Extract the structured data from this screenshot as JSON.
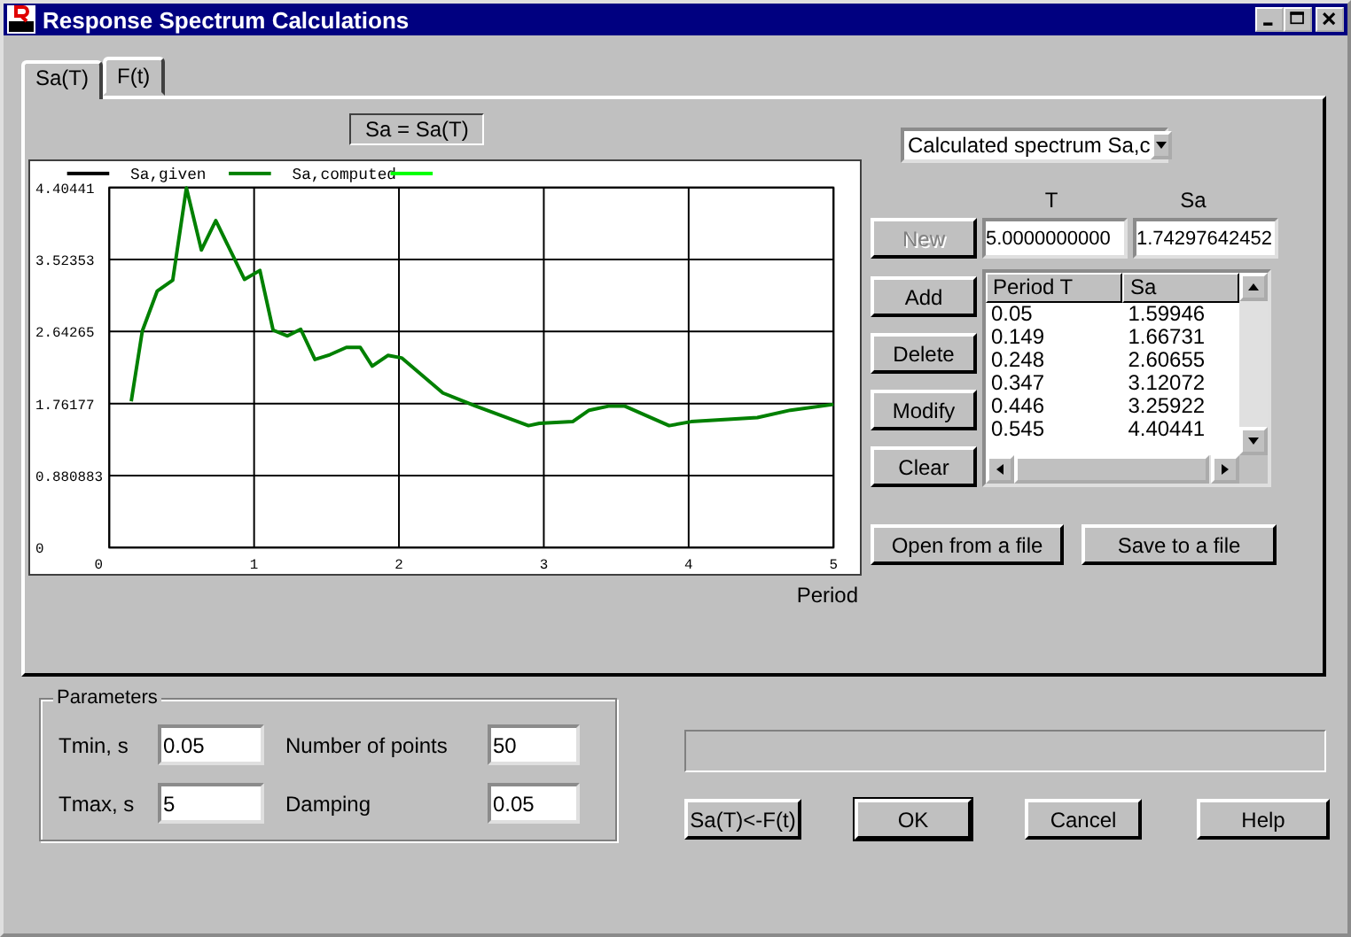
{
  "window": {
    "title": "Response Spectrum Calculations"
  },
  "tabs": [
    {
      "label": "Sa(T)",
      "selected": true
    },
    {
      "label": "F(t)",
      "selected": false
    }
  ],
  "chart": {
    "caption": "Sa = Sa(T)",
    "chart_data": {
      "type": "line",
      "grid": true,
      "xlabel": "Period",
      "xlim": [
        0,
        5
      ],
      "ylim": [
        0,
        4.40441
      ],
      "x": [
        0.152,
        0.228,
        0.331,
        0.438,
        0.533,
        0.636,
        0.735,
        0.933,
        1.04,
        1.131,
        1.23,
        1.321,
        1.42,
        1.523,
        1.637,
        1.733,
        1.816,
        1.923,
        2.018,
        2.304,
        2.532,
        2.894,
        2.97,
        3.199,
        3.313,
        3.446,
        3.56,
        3.865,
        4.017,
        4.474,
        4.703,
        5.0
      ],
      "series": [
        {
          "name": "Sa,given",
          "color": "#000000",
          "values": [
            null,
            null,
            null,
            null,
            null,
            null,
            null,
            null,
            null,
            null,
            null,
            null,
            null,
            null,
            null,
            null,
            null,
            null,
            null,
            null,
            null,
            null,
            null,
            null,
            null,
            null,
            null,
            null,
            null,
            null,
            null,
            null
          ]
        },
        {
          "name": "Sa,computed",
          "color": "#008000",
          "values": [
            1.79,
            2.65,
            3.14,
            3.27,
            4.4,
            3.64,
            4.0,
            3.28,
            3.39,
            2.66,
            2.59,
            2.67,
            2.3,
            2.36,
            2.45,
            2.45,
            2.22,
            2.35,
            2.32,
            1.89,
            1.73,
            1.49,
            1.52,
            1.54,
            1.68,
            1.73,
            1.73,
            1.49,
            1.54,
            1.59,
            1.68,
            1.75
          ]
        },
        {
          "color": "#00ff00",
          "values": [
            null,
            null,
            null,
            null,
            null,
            null,
            null,
            null,
            null,
            null,
            null,
            null,
            null,
            null,
            null,
            null,
            null,
            null,
            null,
            null,
            null,
            null,
            null,
            null,
            null,
            null,
            null,
            null,
            null,
            null,
            null,
            null
          ]
        }
      ],
      "xticks": [
        0,
        1,
        2,
        3,
        4,
        5
      ],
      "yticks": [
        {
          "value": 0,
          "label": "0"
        },
        {
          "value": 0.880883,
          "label": "0.880883"
        },
        {
          "value": 1.76177,
          "label": "1.76177"
        },
        {
          "value": 2.64265,
          "label": "2.64265"
        },
        {
          "value": 3.52353,
          "label": "3.52353"
        },
        {
          "value": 4.40441,
          "label": "4.40441"
        }
      ]
    }
  },
  "source_select": {
    "value": "Calculated spectrum Sa,c"
  },
  "entry": {
    "t_label": "T",
    "sa_label": "Sa",
    "t_value": "5.0000000000",
    "sa_value": "1.74297642452"
  },
  "side_buttons": [
    {
      "label": "New",
      "disabled": true
    },
    {
      "label": "Add",
      "disabled": false
    },
    {
      "label": "Delete",
      "disabled": false
    },
    {
      "label": "Modify",
      "disabled": false
    },
    {
      "label": "Clear",
      "disabled": false
    }
  ],
  "table": {
    "columns": [
      "Period T",
      "Sa"
    ],
    "rows": [
      [
        "0.05",
        "1.59946"
      ],
      [
        "0.149",
        "1.66731"
      ],
      [
        "0.248",
        "2.60655"
      ],
      [
        "0.347",
        "3.12072"
      ],
      [
        "0.446",
        "3.25922"
      ],
      [
        "0.545",
        "4.40441"
      ]
    ]
  },
  "file_buttons": [
    "Open from a file",
    "Save to a file"
  ],
  "parameters": {
    "title": "Parameters",
    "fields": [
      {
        "label": "Tmin, s",
        "value": "0.05"
      },
      {
        "label": "Number of points",
        "value": "50"
      },
      {
        "label": "Tmax, s",
        "value": "5"
      },
      {
        "label": "Damping",
        "value": "0.05"
      }
    ]
  },
  "progress": {
    "level": 0
  },
  "buttons": [
    {
      "label": "Sa(T)<-F(t)",
      "default": false
    },
    {
      "label": "OK",
      "default": true
    },
    {
      "label": "Cancel",
      "default": false
    },
    {
      "label": "Help",
      "default": false
    }
  ]
}
